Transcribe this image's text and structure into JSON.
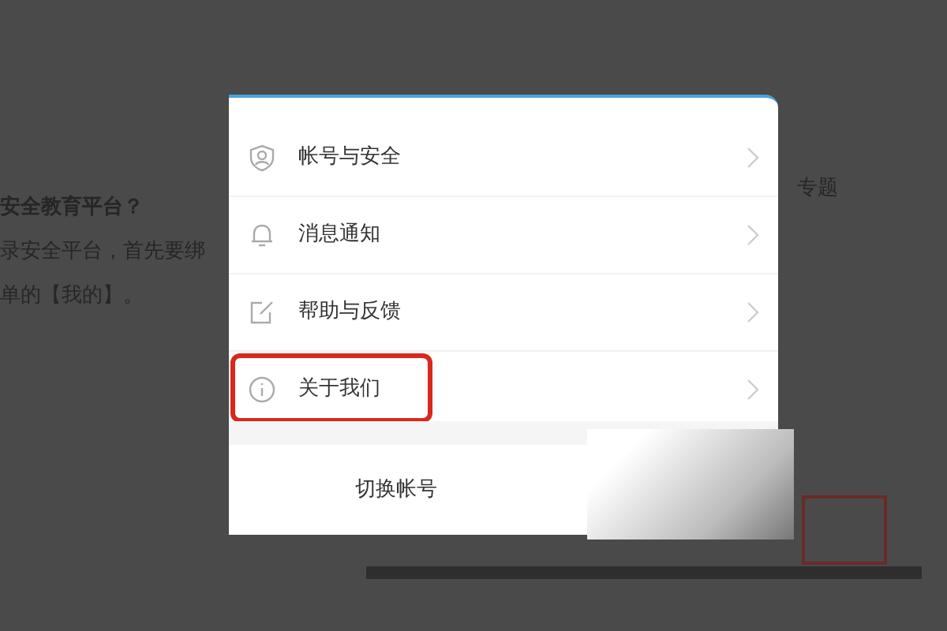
{
  "background_page": {
    "heading": "安全教育平台？",
    "lines": [
      "录安全平台，首先要绑",
      "单的【我的】。"
    ],
    "side_label": "专题"
  },
  "menu": {
    "items": [
      {
        "label": "帐号与安全",
        "highlighted": false
      },
      {
        "label": "消息通知",
        "highlighted": false
      },
      {
        "label": "帮助与反馈",
        "highlighted": false
      },
      {
        "label": "关于我们",
        "highlighted": true
      }
    ],
    "switch_button": "切换帐号"
  }
}
